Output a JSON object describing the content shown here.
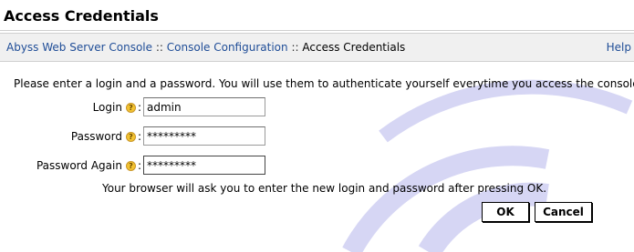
{
  "window": {
    "title": "Access Credentials"
  },
  "breadcrumb": {
    "items": [
      "Abyss Web Server Console",
      "Console Configuration",
      "Access Credentials"
    ],
    "separator": "::",
    "help_label": "Help"
  },
  "form": {
    "intro": "Please enter a login and a password. You will use them to authenticate yourself everytime you access the console.",
    "login": {
      "label": "Login",
      "value": "admin"
    },
    "password": {
      "label": "Password",
      "value": "*********"
    },
    "password_again": {
      "label": "Password Again",
      "value": "*********"
    },
    "note": "Your browser will ask you to enter the new login and password after pressing OK.",
    "ok_label": "OK",
    "cancel_label": "Cancel",
    "help_icon_glyph": "?",
    "label_suffix": ":"
  },
  "colors": {
    "link": "#1f4d97",
    "crumb_bg": "#f0f0f0",
    "watermark": "#d6d6f4"
  },
  "icons": {
    "field_help": "question-circle-icon"
  }
}
